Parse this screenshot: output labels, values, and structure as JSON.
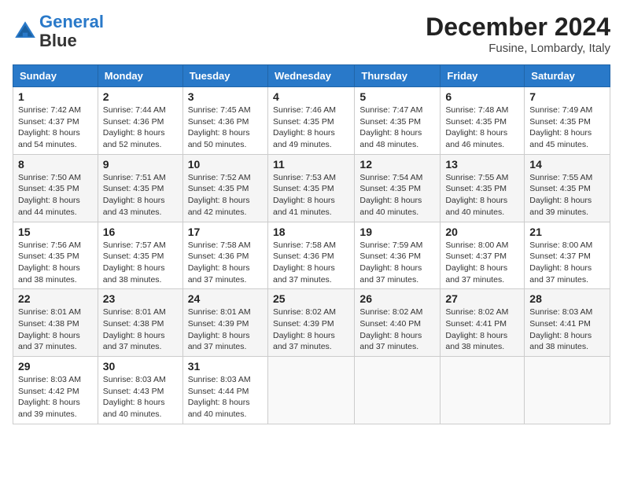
{
  "header": {
    "logo_line1": "General",
    "logo_line2": "Blue",
    "month": "December 2024",
    "location": "Fusine, Lombardy, Italy"
  },
  "days_of_week": [
    "Sunday",
    "Monday",
    "Tuesday",
    "Wednesday",
    "Thursday",
    "Friday",
    "Saturday"
  ],
  "weeks": [
    [
      {
        "day": "1",
        "sunrise": "7:42 AM",
        "sunset": "4:37 PM",
        "daylight": "8 hours and 54 minutes."
      },
      {
        "day": "2",
        "sunrise": "7:44 AM",
        "sunset": "4:36 PM",
        "daylight": "8 hours and 52 minutes."
      },
      {
        "day": "3",
        "sunrise": "7:45 AM",
        "sunset": "4:36 PM",
        "daylight": "8 hours and 50 minutes."
      },
      {
        "day": "4",
        "sunrise": "7:46 AM",
        "sunset": "4:35 PM",
        "daylight": "8 hours and 49 minutes."
      },
      {
        "day": "5",
        "sunrise": "7:47 AM",
        "sunset": "4:35 PM",
        "daylight": "8 hours and 48 minutes."
      },
      {
        "day": "6",
        "sunrise": "7:48 AM",
        "sunset": "4:35 PM",
        "daylight": "8 hours and 46 minutes."
      },
      {
        "day": "7",
        "sunrise": "7:49 AM",
        "sunset": "4:35 PM",
        "daylight": "8 hours and 45 minutes."
      }
    ],
    [
      {
        "day": "8",
        "sunrise": "7:50 AM",
        "sunset": "4:35 PM",
        "daylight": "8 hours and 44 minutes."
      },
      {
        "day": "9",
        "sunrise": "7:51 AM",
        "sunset": "4:35 PM",
        "daylight": "8 hours and 43 minutes."
      },
      {
        "day": "10",
        "sunrise": "7:52 AM",
        "sunset": "4:35 PM",
        "daylight": "8 hours and 42 minutes."
      },
      {
        "day": "11",
        "sunrise": "7:53 AM",
        "sunset": "4:35 PM",
        "daylight": "8 hours and 41 minutes."
      },
      {
        "day": "12",
        "sunrise": "7:54 AM",
        "sunset": "4:35 PM",
        "daylight": "8 hours and 40 minutes."
      },
      {
        "day": "13",
        "sunrise": "7:55 AM",
        "sunset": "4:35 PM",
        "daylight": "8 hours and 40 minutes."
      },
      {
        "day": "14",
        "sunrise": "7:55 AM",
        "sunset": "4:35 PM",
        "daylight": "8 hours and 39 minutes."
      }
    ],
    [
      {
        "day": "15",
        "sunrise": "7:56 AM",
        "sunset": "4:35 PM",
        "daylight": "8 hours and 38 minutes."
      },
      {
        "day": "16",
        "sunrise": "7:57 AM",
        "sunset": "4:35 PM",
        "daylight": "8 hours and 38 minutes."
      },
      {
        "day": "17",
        "sunrise": "7:58 AM",
        "sunset": "4:36 PM",
        "daylight": "8 hours and 37 minutes."
      },
      {
        "day": "18",
        "sunrise": "7:58 AM",
        "sunset": "4:36 PM",
        "daylight": "8 hours and 37 minutes."
      },
      {
        "day": "19",
        "sunrise": "7:59 AM",
        "sunset": "4:36 PM",
        "daylight": "8 hours and 37 minutes."
      },
      {
        "day": "20",
        "sunrise": "8:00 AM",
        "sunset": "4:37 PM",
        "daylight": "8 hours and 37 minutes."
      },
      {
        "day": "21",
        "sunrise": "8:00 AM",
        "sunset": "4:37 PM",
        "daylight": "8 hours and 37 minutes."
      }
    ],
    [
      {
        "day": "22",
        "sunrise": "8:01 AM",
        "sunset": "4:38 PM",
        "daylight": "8 hours and 37 minutes."
      },
      {
        "day": "23",
        "sunrise": "8:01 AM",
        "sunset": "4:38 PM",
        "daylight": "8 hours and 37 minutes."
      },
      {
        "day": "24",
        "sunrise": "8:01 AM",
        "sunset": "4:39 PM",
        "daylight": "8 hours and 37 minutes."
      },
      {
        "day": "25",
        "sunrise": "8:02 AM",
        "sunset": "4:39 PM",
        "daylight": "8 hours and 37 minutes."
      },
      {
        "day": "26",
        "sunrise": "8:02 AM",
        "sunset": "4:40 PM",
        "daylight": "8 hours and 37 minutes."
      },
      {
        "day": "27",
        "sunrise": "8:02 AM",
        "sunset": "4:41 PM",
        "daylight": "8 hours and 38 minutes."
      },
      {
        "day": "28",
        "sunrise": "8:03 AM",
        "sunset": "4:41 PM",
        "daylight": "8 hours and 38 minutes."
      }
    ],
    [
      {
        "day": "29",
        "sunrise": "8:03 AM",
        "sunset": "4:42 PM",
        "daylight": "8 hours and 39 minutes."
      },
      {
        "day": "30",
        "sunrise": "8:03 AM",
        "sunset": "4:43 PM",
        "daylight": "8 hours and 40 minutes."
      },
      {
        "day": "31",
        "sunrise": "8:03 AM",
        "sunset": "4:44 PM",
        "daylight": "8 hours and 40 minutes."
      },
      null,
      null,
      null,
      null
    ]
  ]
}
